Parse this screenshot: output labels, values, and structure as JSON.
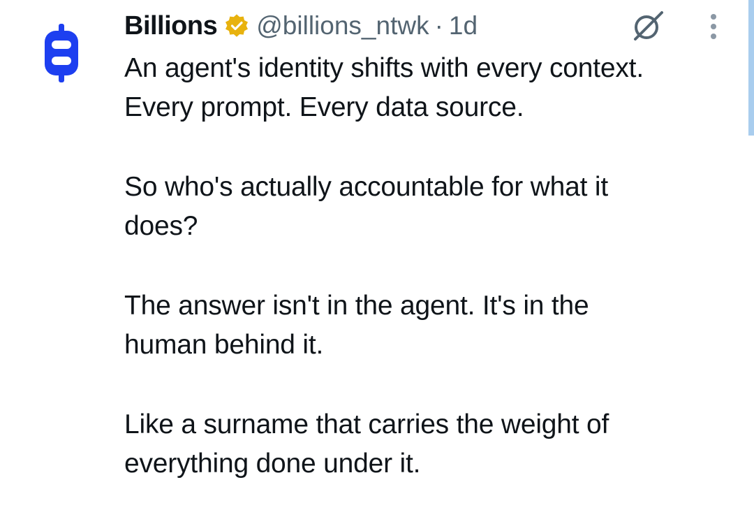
{
  "author": {
    "display_name": "Billions",
    "handle": "@billions_ntwk",
    "separator": "·",
    "time": "1d",
    "avatar_icon": "billions-logo-icon",
    "verified_icon": "verified-gold-badge-icon"
  },
  "actions": {
    "grok_icon": "grok-icon",
    "more_icon": "more-vertical-icon"
  },
  "tweet": {
    "paragraphs": [
      "An agent's identity shifts with every context.\nEvery prompt. Every data source.",
      "So who's actually accountable for what it\ndoes?",
      "The answer isn't in the agent. It's in the\nhuman behind it.",
      "Like a surname that carries the weight of\neverything done under it."
    ]
  },
  "colors": {
    "brand_blue": "#1d3ff0",
    "verified_gold": "#e8b20e",
    "secondary_text": "#536471",
    "scrollbar": "#a9cdee"
  }
}
